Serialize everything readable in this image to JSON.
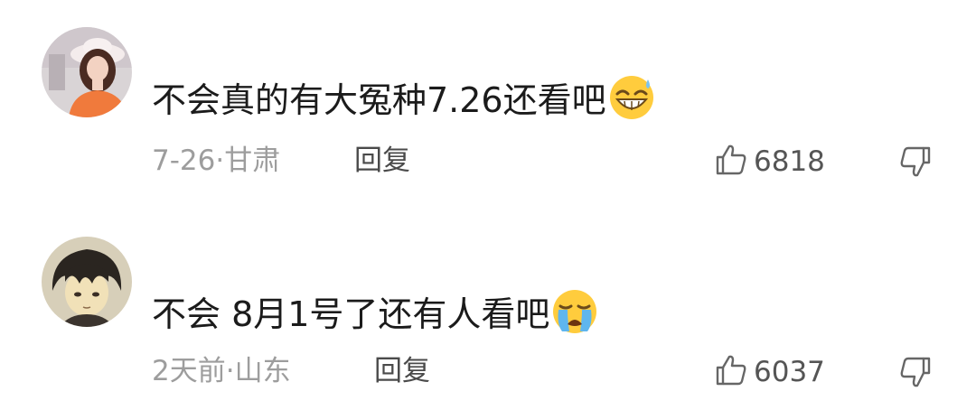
{
  "comments": [
    {
      "text": "不会真的有大冤种7.26还看吧",
      "emoji": "grinning-sweat-emoji",
      "time": "7-26",
      "separator": "·",
      "location": "甘肃",
      "reply_label": "回复",
      "likes": "6818"
    },
    {
      "text": "不会 8月1号了还有人看吧",
      "emoji": "loudly-crying-emoji",
      "time": "2天前",
      "separator": "·",
      "location": "山东",
      "reply_label": "回复",
      "likes": "6037"
    }
  ],
  "icons": {
    "like": "thumbs-up-outline-icon",
    "dislike": "thumbs-down-outline-icon"
  },
  "colors": {
    "text": "#1b1b1b",
    "meta": "#9d9d9d",
    "reply": "#4a4a4a",
    "background": "#ffffff"
  }
}
